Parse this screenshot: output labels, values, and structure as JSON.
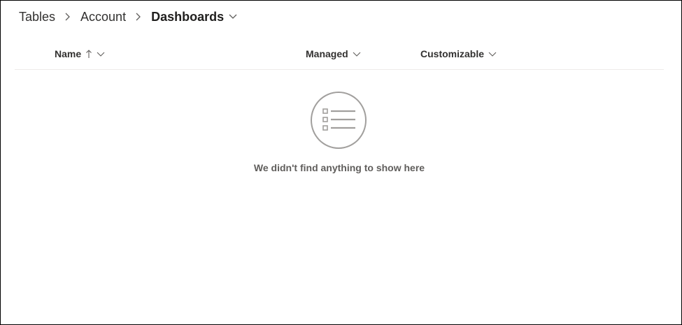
{
  "breadcrumb": {
    "items": [
      "Tables",
      "Account"
    ],
    "current": "Dashboards"
  },
  "table": {
    "columns": [
      {
        "label": "Name",
        "sorted": "ascending"
      },
      {
        "label": "Managed"
      },
      {
        "label": "Customizable"
      }
    ]
  },
  "empty_state": {
    "icon": "list-icon",
    "message": "We didn't find anything to show here"
  },
  "colors": {
    "text": "#323130",
    "muted": "#605e5c",
    "icon": "#a19f9d",
    "divider": "#edebe9"
  }
}
